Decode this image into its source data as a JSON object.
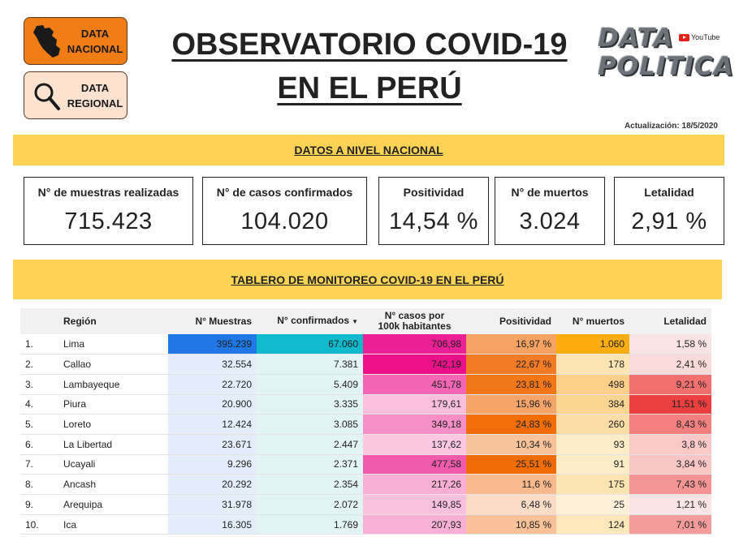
{
  "nav": {
    "nacional_label": "DATA NACIONAL",
    "regional_label": "DATA REGIONAL"
  },
  "header": {
    "title_line1": "OBSERVATORIO  COVID-19",
    "title_line2": "EN EL PERÚ",
    "brand_line1": "DATA",
    "brand_line2": "POLITICA",
    "youtube_label": "YouTube",
    "update": "Actualización: 18/5/2020"
  },
  "section_nacional": {
    "title": "DATOS A NIVEL NACIONAL"
  },
  "cards": [
    {
      "label": "N° de muestras realizadas",
      "value": "715.423"
    },
    {
      "label": "N° de casos confirmados",
      "value": "104.020"
    },
    {
      "label": "Positividad",
      "value": "14,54 %"
    },
    {
      "label": "N° de muertos",
      "value": "3.024"
    },
    {
      "label": "Letalidad",
      "value": "2,91 %"
    }
  ],
  "section_tablero": {
    "title": "TABLERO DE MONITOREO COVID-19 EN EL PERÚ"
  },
  "table": {
    "headers": {
      "region": "Región",
      "muestras": "N° Muestras",
      "confirmados": "N° confirmados",
      "casos100k_line1": "N° casos por",
      "casos100k_line2": "100k habitantes",
      "positividad": "Positividad",
      "muertos": "N° muertos",
      "letalidad": "Letalidad"
    },
    "sort_indicator": "▼",
    "rows": [
      {
        "idx": "1.",
        "region": "Lima",
        "muestras": "395.239",
        "confirmados": "67.060",
        "casos100k": "706,98",
        "positividad": "16,97 %",
        "muertos": "1.060",
        "letalidad": "1,58 %"
      },
      {
        "idx": "2.",
        "region": "Callao",
        "muestras": "32.554",
        "confirmados": "7.381",
        "casos100k": "742,19",
        "positividad": "22,67 %",
        "muertos": "178",
        "letalidad": "2,41 %"
      },
      {
        "idx": "3.",
        "region": "Lambayeque",
        "muestras": "22.720",
        "confirmados": "5.409",
        "casos100k": "451,78",
        "positividad": "23,81 %",
        "muertos": "498",
        "letalidad": "9,21 %"
      },
      {
        "idx": "4.",
        "region": "Piura",
        "muestras": "20.900",
        "confirmados": "3.335",
        "casos100k": "179,61",
        "positividad": "15,96 %",
        "muertos": "384",
        "letalidad": "11,51 %"
      },
      {
        "idx": "5.",
        "region": "Loreto",
        "muestras": "12.424",
        "confirmados": "3.085",
        "casos100k": "349,18",
        "positividad": "24,83 %",
        "muertos": "260",
        "letalidad": "8,43 %"
      },
      {
        "idx": "6.",
        "region": "La Libertad",
        "muestras": "23.671",
        "confirmados": "2.447",
        "casos100k": "137,62",
        "positividad": "10,34 %",
        "muertos": "93",
        "letalidad": "3,8 %"
      },
      {
        "idx": "7.",
        "region": "Ucayali",
        "muestras": "9.296",
        "confirmados": "2.371",
        "casos100k": "477,58",
        "positividad": "25,51 %",
        "muertos": "91",
        "letalidad": "3,84 %"
      },
      {
        "idx": "8.",
        "region": "Ancash",
        "muestras": "20.292",
        "confirmados": "2.354",
        "casos100k": "217,26",
        "positividad": "11,6 %",
        "muertos": "175",
        "letalidad": "7,43 %"
      },
      {
        "idx": "9.",
        "region": "Arequipa",
        "muestras": "31.978",
        "confirmados": "2.072",
        "casos100k": "149,85",
        "positividad": "6,48 %",
        "muertos": "25",
        "letalidad": "1,21 %"
      },
      {
        "idx": "10.",
        "region": "Ica",
        "muestras": "16.305",
        "confirmados": "1.769",
        "casos100k": "207,93",
        "positividad": "10,85 %",
        "muertos": "124",
        "letalidad": "7,01 %"
      }
    ],
    "cell_colors": {
      "muestras": [
        "#1f78e6",
        "#e4eefa",
        "#e4eefa",
        "#e4eefa",
        "#e4eefa",
        "#e4eefa",
        "#e4eefa",
        "#e4eefa",
        "#e4eefa",
        "#e4eefa"
      ],
      "confirmados": [
        "#11b9cc",
        "#e3f4f6",
        "#e3f4f6",
        "#e3f4f6",
        "#e3f4f6",
        "#e3f4f6",
        "#e3f4f6",
        "#e3f4f6",
        "#e3f4f6",
        "#e3f4f6"
      ],
      "casos100k": [
        "#ec1f94",
        "#ea1189",
        "#f466b4",
        "#fbbfdd",
        "#f78fc7",
        "#fcc7e1",
        "#f25aac",
        "#f9afd5",
        "#fbc0dd",
        "#f9b0d6"
      ],
      "positividad": [
        "#f5a263",
        "#f27b25",
        "#f27718",
        "#f5a56a",
        "#f16d06",
        "#f8c29a",
        "#f06c04",
        "#f8b98c",
        "#fbdcc6",
        "#f8c198"
      ],
      "muertos": [
        "#fbac0e",
        "#fde4b3",
        "#fdd089",
        "#fdd593",
        "#fddda6",
        "#fdecc8",
        "#fdecc8",
        "#fde4b3",
        "#fdf1d9",
        "#fde7bb"
      ],
      "letalidad": [
        "#fbe3e3",
        "#fbdada",
        "#f07070",
        "#ec4040",
        "#f28080",
        "#f9c8c8",
        "#f9c6c6",
        "#f49494",
        "#fbe5e5",
        "#f49c9c"
      ]
    }
  }
}
